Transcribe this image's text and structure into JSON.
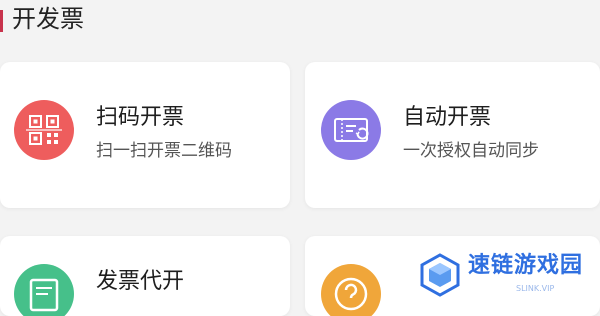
{
  "section": {
    "title": "开发票",
    "accent_color": "#c8334c"
  },
  "cards": [
    {
      "title": "扫码开票",
      "subtitle": "扫一扫开票二维码",
      "icon": "qr-code-icon",
      "icon_color": "#ee5d5d"
    },
    {
      "title": "自动开票",
      "subtitle": "一次授权自动同步",
      "icon": "ticket-sync-icon",
      "icon_color": "#8b7ae6"
    },
    {
      "title": "发票代开",
      "subtitle": "",
      "icon": "document-icon",
      "icon_color": "#46c08a"
    },
    {
      "title": "",
      "subtitle": "",
      "icon": "question-icon",
      "icon_color": "#f0a63a"
    }
  ],
  "watermark": {
    "text": "速链游戏园",
    "subtext": "SLINK.VIP",
    "color": "#2f6fe0"
  }
}
